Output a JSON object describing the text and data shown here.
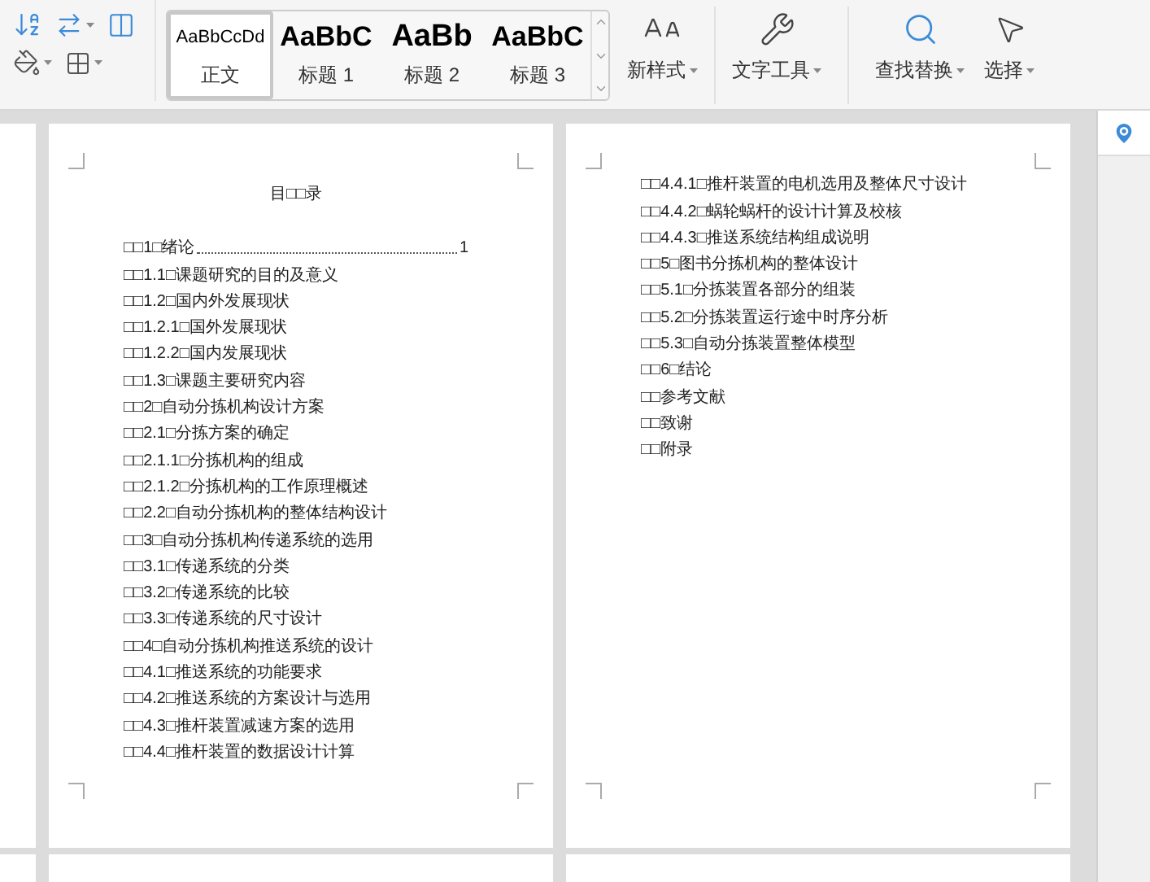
{
  "toolbar": {
    "styles": [
      {
        "preview": "AaBbCcDd",
        "label": "正文",
        "kind": "body",
        "selected": true
      },
      {
        "preview": "AaBbC",
        "label": "标题 1",
        "kind": "h1",
        "selected": false
      },
      {
        "preview": "AaBb",
        "label": "标题 2",
        "kind": "h2",
        "selected": false
      },
      {
        "preview": "AaBbC",
        "label": "标题 3",
        "kind": "h3",
        "selected": false
      }
    ],
    "new_style": "新样式",
    "tools": [
      {
        "label": "文字工具",
        "kind": "wrench"
      },
      {
        "label": "查找替换",
        "kind": "search"
      },
      {
        "label": "选择",
        "kind": "pointer"
      }
    ]
  },
  "pages": [
    {
      "title": "目□□录",
      "entries": [
        {
          "text": "□□1□绪论",
          "page": "1"
        },
        {
          "text": "□□1.1□课题研究的目的及意义"
        },
        {
          "text": "□□1.2□国内外发展现状"
        },
        {
          "text": "□□1.2.1□国外发展现状"
        },
        {
          "text": "□□1.2.2□国内发展现状"
        },
        {
          "text": "□□1.3□课题主要研究内容"
        },
        {
          "text": "□□2□自动分拣机构设计方案"
        },
        {
          "text": "□□2.1□分拣方案的确定"
        },
        {
          "text": "□□2.1.1□分拣机构的组成"
        },
        {
          "text": "□□2.1.2□分拣机构的工作原理概述"
        },
        {
          "text": "□□2.2□自动分拣机构的整体结构设计"
        },
        {
          "text": "□□3□自动分拣机构传递系统的选用"
        },
        {
          "text": "□□3.1□传递系统的分类"
        },
        {
          "text": "□□3.2□传递系统的比较"
        },
        {
          "text": "□□3.3□传递系统的尺寸设计"
        },
        {
          "text": "□□4□自动分拣机构推送系统的设计"
        },
        {
          "text": "□□4.1□推送系统的功能要求"
        },
        {
          "text": "□□4.2□推送系统的方案设计与选用"
        },
        {
          "text": "□□4.3□推杆装置减速方案的选用"
        },
        {
          "text": "□□4.4□推杆装置的数据设计计算"
        }
      ]
    },
    {
      "entries": [
        {
          "text": "□□4.4.1□推杆装置的电机选用及整体尺寸设计"
        },
        {
          "text": "□□4.4.2□蜗轮蜗杆的设计计算及校核"
        },
        {
          "text": "□□4.4.3□推送系统结构组成说明"
        },
        {
          "text": "□□5□图书分拣机构的整体设计"
        },
        {
          "text": "□□5.1□分拣装置各部分的组装"
        },
        {
          "text": "□□5.2□分拣装置运行途中时序分析"
        },
        {
          "text": "□□5.3□自动分拣装置整体模型"
        },
        {
          "text": "□□6□结论"
        },
        {
          "text": "□□参考文献"
        },
        {
          "text": "□□致谢"
        },
        {
          "text": "□□附录"
        }
      ]
    }
  ]
}
